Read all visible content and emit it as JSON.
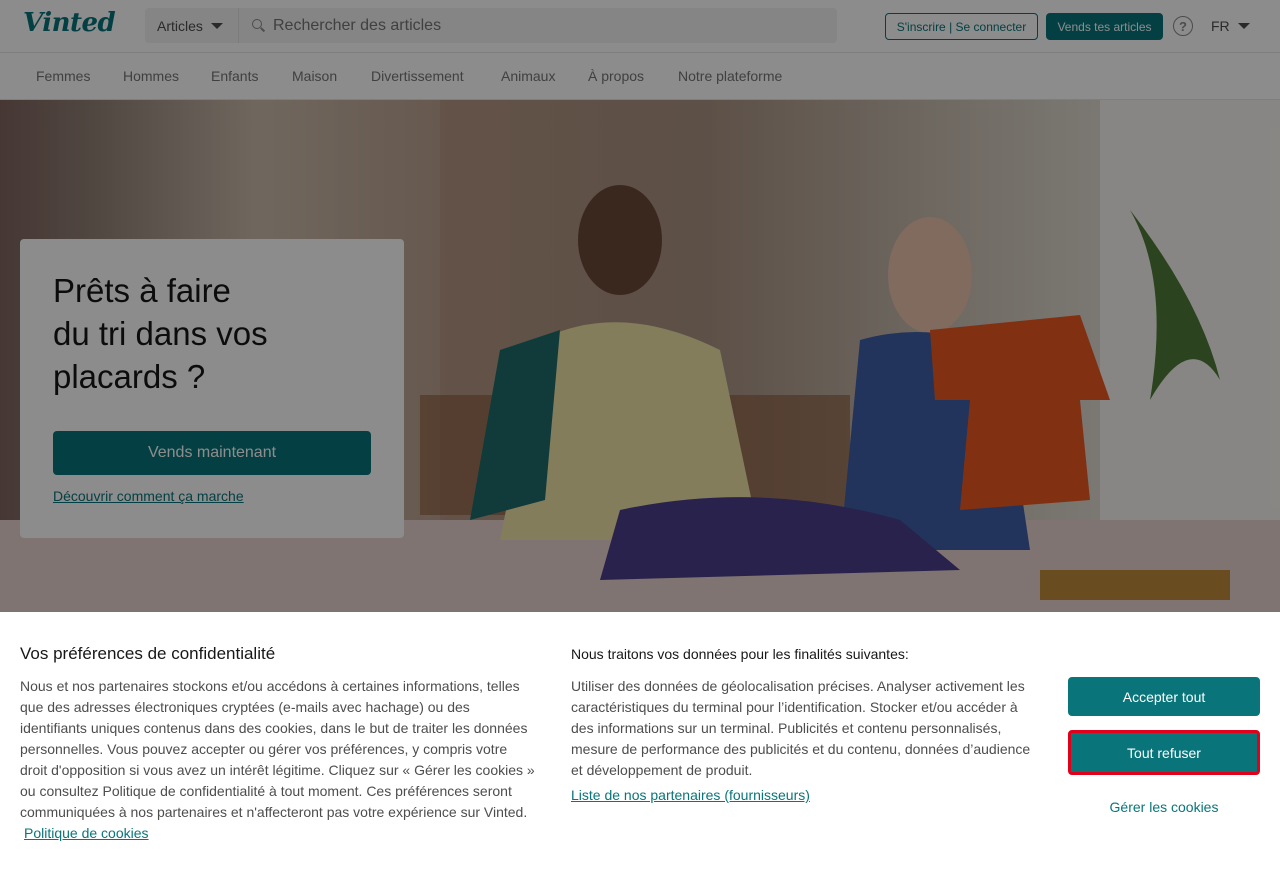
{
  "header": {
    "logo": "Vinted",
    "search_category": "Articles",
    "search_placeholder": "Rechercher des articles",
    "login_label": "S'inscrire | Se connecter",
    "sell_label": "Vends tes articles",
    "help_icon": "?",
    "language": "FR"
  },
  "nav": {
    "items": [
      "Femmes",
      "Hommes",
      "Enfants",
      "Maison",
      "Divertissement",
      "Animaux",
      "À propos",
      "Notre plateforme"
    ]
  },
  "hero": {
    "title_line1": "Prêts à faire",
    "title_line2": "du tri dans vos",
    "title_line3": "placards ?",
    "cta_label": "Vends maintenant",
    "link_label": "Découvrir comment ça marche"
  },
  "cookie": {
    "title": "Vos préférences de confidentialité",
    "text": "Nous et nos partenaires stockons et/ou accédons à certaines informations, telles que des adresses électroniques cryptées (e-mails avec hachage) ou des identifiants uniques contenus dans des cookies, dans le but de traiter les données personnelles. Vous pouvez accepter ou gérer vos préférences, y compris votre droit d'opposition si vous avez un intérêt légitime. Cliquez sur « Gérer les cookies » ou consultez Politique de confidentialité à tout moment. Ces préférences seront communiquées à nos partenaires et n'affecteront pas votre expérience sur Vinted.",
    "policy_link": "Politique de cookies",
    "purposes_title": "Nous traitons vos données pour les finalités suivantes:",
    "purposes_text": "Utiliser des données de géolocalisation précises. Analyser activement les caractéristiques du terminal pour l’identification. Stocker et/ou accéder à des informations sur un terminal. Publicités et contenu personnalisés, mesure de performance des publicités et du contenu, données d’audience et développement de produit.",
    "partners_link": "Liste de nos partenaires (fournisseurs)",
    "accept_label": "Accepter tout",
    "refuse_label": "Tout refuser",
    "manage_label": "Gérer les cookies"
  },
  "colors": {
    "brand": "#09757a",
    "highlight": "#e0001b"
  }
}
